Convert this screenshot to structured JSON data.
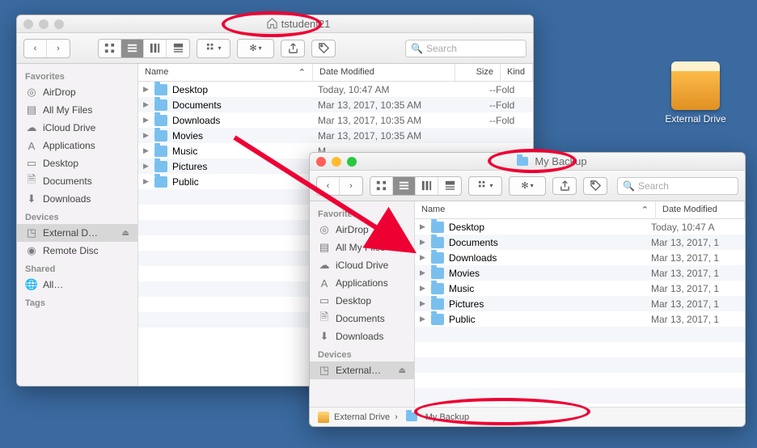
{
  "desktop": {
    "drive_label": "External Drive"
  },
  "win1": {
    "title": "tstudent21",
    "search_placeholder": "Search",
    "cols": {
      "name": "Name",
      "date": "Date Modified",
      "size": "Size",
      "kind": "Kind"
    },
    "sidebar": {
      "favorites_head": "Favorites",
      "favorites": [
        {
          "label": "AirDrop"
        },
        {
          "label": "All My Files"
        },
        {
          "label": "iCloud Drive"
        },
        {
          "label": "Applications"
        },
        {
          "label": "Desktop"
        },
        {
          "label": "Documents"
        },
        {
          "label": "Downloads"
        }
      ],
      "devices_head": "Devices",
      "devices": [
        {
          "label": "External D…"
        },
        {
          "label": "Remote Disc"
        }
      ],
      "shared_head": "Shared",
      "shared": [
        {
          "label": "All…"
        }
      ],
      "tags_head": "Tags"
    },
    "rows": [
      {
        "name": "Desktop",
        "date": "Today, 10:47 AM",
        "size": "--",
        "kind": "Fold"
      },
      {
        "name": "Documents",
        "date": "Mar 13, 2017, 10:35 AM",
        "size": "--",
        "kind": "Fold"
      },
      {
        "name": "Downloads",
        "date": "Mar 13, 2017, 10:35 AM",
        "size": "--",
        "kind": "Fold"
      },
      {
        "name": "Movies",
        "date": "Mar 13, 2017, 10:35 AM",
        "size": "",
        "kind": ""
      },
      {
        "name": "Music",
        "date": "M",
        "size": "",
        "kind": ""
      },
      {
        "name": "Pictures",
        "date": "M",
        "size": "",
        "kind": ""
      },
      {
        "name": "Public",
        "date": "M",
        "size": "",
        "kind": ""
      }
    ]
  },
  "win2": {
    "title": "My Backup",
    "search_placeholder": "Search",
    "cols": {
      "name": "Name",
      "date": "Date Modified"
    },
    "sidebar": {
      "favorites_head": "Favorites",
      "favorites": [
        {
          "label": "AirDrop"
        },
        {
          "label": "All My Files"
        },
        {
          "label": "iCloud Drive"
        },
        {
          "label": "Applications"
        },
        {
          "label": "Desktop"
        },
        {
          "label": "Documents"
        },
        {
          "label": "Downloads"
        }
      ],
      "devices_head": "Devices",
      "devices": [
        {
          "label": "External…"
        }
      ]
    },
    "rows": [
      {
        "name": "Desktop",
        "date": "Today, 10:47 A"
      },
      {
        "name": "Documents",
        "date": "Mar 13, 2017, 1"
      },
      {
        "name": "Downloads",
        "date": "Mar 13, 2017, 1"
      },
      {
        "name": "Movies",
        "date": "Mar 13, 2017, 1"
      },
      {
        "name": "Music",
        "date": "Mar 13, 2017, 1"
      },
      {
        "name": "Pictures",
        "date": "Mar 13, 2017, 1"
      },
      {
        "name": "Public",
        "date": "Mar 13, 2017, 1"
      }
    ],
    "path": {
      "a": "External Drive",
      "b": "My Backup",
      "sep": "›"
    }
  }
}
